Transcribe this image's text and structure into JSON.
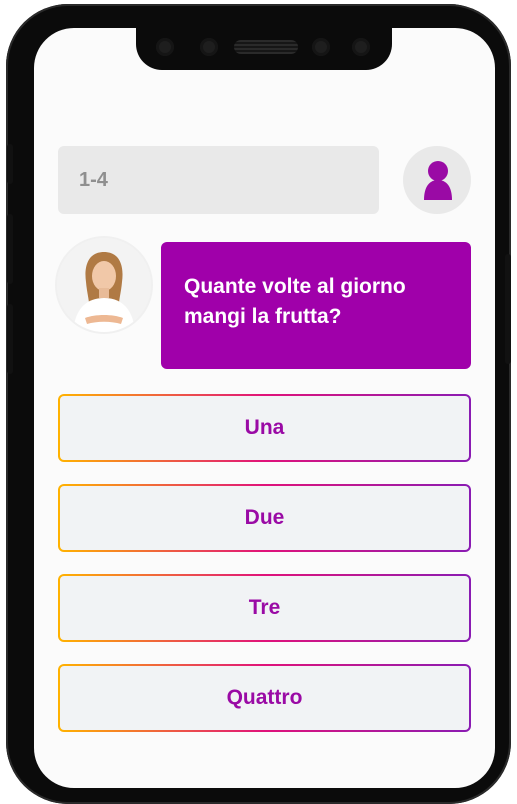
{
  "header": {
    "range_label": "1-4"
  },
  "chat": {
    "question": "Quante volte al giorno mangi la frutta?"
  },
  "answers": [
    {
      "label": "Una"
    },
    {
      "label": "Due"
    },
    {
      "label": "Tre"
    },
    {
      "label": "Quattro"
    }
  ],
  "icons": {
    "user": "user-icon",
    "assistant": "assistant-avatar"
  },
  "colors": {
    "accent": "#a000aa",
    "answer_text": "#9a0aa5",
    "answer_border_gradient": [
      "#ffb300",
      "#e0127a",
      "#8a1bb3"
    ],
    "input_bg": "#e9e9e9"
  }
}
